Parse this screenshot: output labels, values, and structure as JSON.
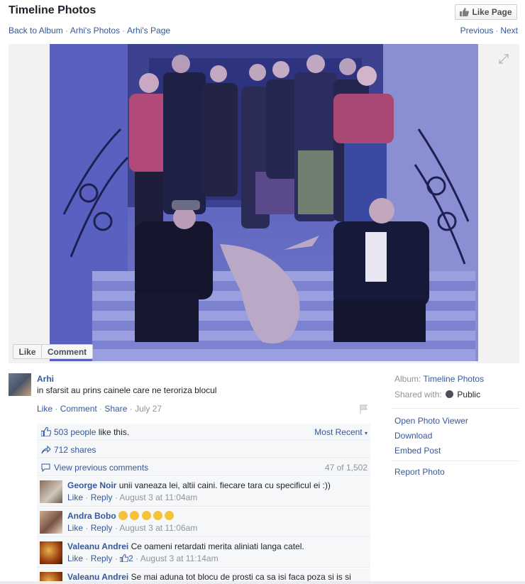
{
  "header": {
    "title": "Timeline Photos",
    "like_page": "Like Page",
    "breadcrumbs": [
      "Back to Album",
      "Arhi's Photos",
      "Arhi's Page"
    ],
    "prev": "Previous",
    "next": "Next"
  },
  "photo": {
    "like_btn": "Like",
    "comment_btn": "Comment"
  },
  "post": {
    "author": "Arhi",
    "caption": "in sfarsit au prins cainele care ne teroriza blocul",
    "actions": [
      "Like",
      "Comment",
      "Share"
    ],
    "date": "July 27",
    "likes_count": "503 people",
    "likes_suffix": " like this.",
    "sort": "Most Recent",
    "shares": "712 shares",
    "view_previous": "View previous comments",
    "comment_range": "47 of 1,502"
  },
  "comments": [
    {
      "name": "George Noir",
      "text": "unii vaneaza lei, altii caini. fiecare tara cu specificul ei :))",
      "like": "Like",
      "reply": "Reply",
      "time": "August 3 at 11:04am",
      "reactions": ""
    },
    {
      "name": "Andra Bobo",
      "text": "",
      "like": "Like",
      "reply": "Reply",
      "time": "August 3 at 11:06am",
      "reactions": ""
    },
    {
      "name": "Valeanu Andrei",
      "text": "Ce oameni retardati merita aliniati langa catel.",
      "like": "Like",
      "reply": "Reply",
      "time": "August 3 at 11:14am",
      "reactions": "2"
    },
    {
      "name": "Valeanu Andrei",
      "text": "Se mai aduna tot blocu de prosti ca sa isi faca poza si is si",
      "like": "",
      "reply": "",
      "time": "",
      "reactions": ""
    }
  ],
  "sidebar": {
    "album_label": "Album:",
    "album_name": "Timeline Photos",
    "shared_label": "Shared with:",
    "shared_value": "Public",
    "links": [
      "Open Photo Viewer",
      "Download",
      "Embed Post"
    ],
    "report": "Report Photo"
  },
  "colors": {
    "link": "#365899",
    "grey": "#90949c",
    "ufi_bg": "#f6f7f9"
  }
}
